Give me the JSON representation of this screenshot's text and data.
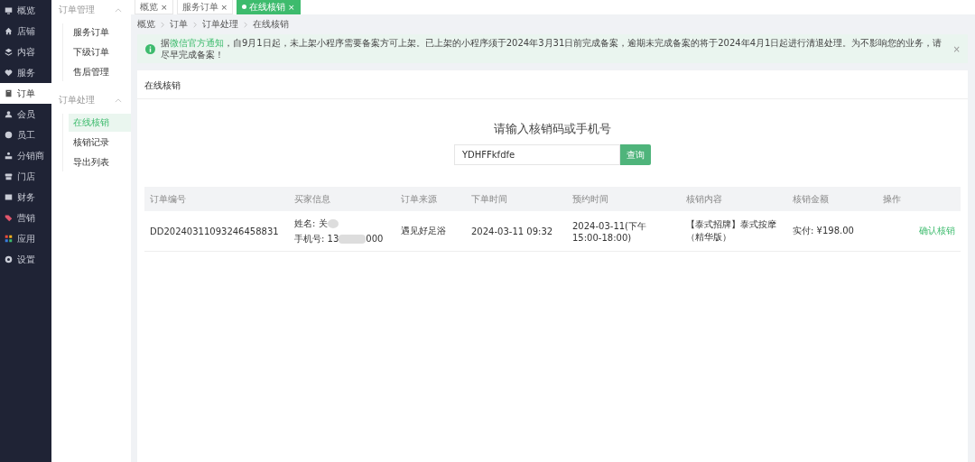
{
  "sidebar": {
    "items": [
      {
        "label": "概览",
        "selected": false
      },
      {
        "label": "店铺",
        "selected": false
      },
      {
        "label": "内容",
        "selected": false
      },
      {
        "label": "服务",
        "selected": false
      },
      {
        "label": "订单",
        "selected": true
      },
      {
        "label": "会员",
        "selected": false
      },
      {
        "label": "员工",
        "selected": false
      },
      {
        "label": "分销商",
        "selected": false
      },
      {
        "label": "门店",
        "selected": false
      },
      {
        "label": "财务",
        "selected": false
      },
      {
        "label": "营销",
        "selected": false
      },
      {
        "label": "应用",
        "selected": false
      },
      {
        "label": "设置",
        "selected": false
      }
    ]
  },
  "submenu": {
    "groups": [
      {
        "title": "订单管理",
        "expanded": true,
        "items": [
          {
            "label": "服务订单",
            "selected": false
          },
          {
            "label": "下级订单",
            "selected": false
          },
          {
            "label": "售后管理",
            "selected": false
          }
        ]
      },
      {
        "title": "订单处理",
        "expanded": true,
        "items": [
          {
            "label": "在线核销",
            "selected": true
          },
          {
            "label": "核销记录",
            "selected": false
          },
          {
            "label": "导出列表",
            "selected": false
          }
        ]
      }
    ]
  },
  "tabs": [
    {
      "label": "概览",
      "close": "×",
      "selected": false
    },
    {
      "label": "服务订单",
      "close": "×",
      "selected": false
    },
    {
      "label": "在线核销",
      "close": "×",
      "selected": true
    }
  ],
  "breadcrumb": [
    "概览",
    "订单",
    "订单处理",
    "在线核销"
  ],
  "notice": {
    "prefix": "据",
    "link": "微信官方通知",
    "text": "，自9月1日起，未上架小程序需要备案方可上架。已上架的小程序须于2024年3月31日前完成备案，逾期未完成备案的将于2024年4月1日起进行清退处理。为不影响您的业务，请尽早完成备案！",
    "close": "×"
  },
  "card": {
    "title": "在线核销",
    "search": {
      "heading": "请输入核销码或手机号",
      "value": "YDHFFkfdfe",
      "button": "查询"
    },
    "table": {
      "columns": [
        "订单编号",
        "买家信息",
        "订单来源",
        "下单时间",
        "预约时间",
        "核销内容",
        "核销金额",
        "操作"
      ],
      "rows": [
        {
          "order_no": "DD20240311093246458831",
          "buyer_name": "姓名: 关",
          "buyer_phone_start": "手机号: 13",
          "buyer_phone_end": "000",
          "source": "遇见好足浴",
          "order_time": "2024-03-11 09:32",
          "booking_time": "2024-03-11(下午 15:00-18:00)",
          "content": "【泰式招牌】泰式按摩（精华版）",
          "amount": "实付: ¥198.00",
          "action": "确认核销"
        }
      ]
    }
  }
}
